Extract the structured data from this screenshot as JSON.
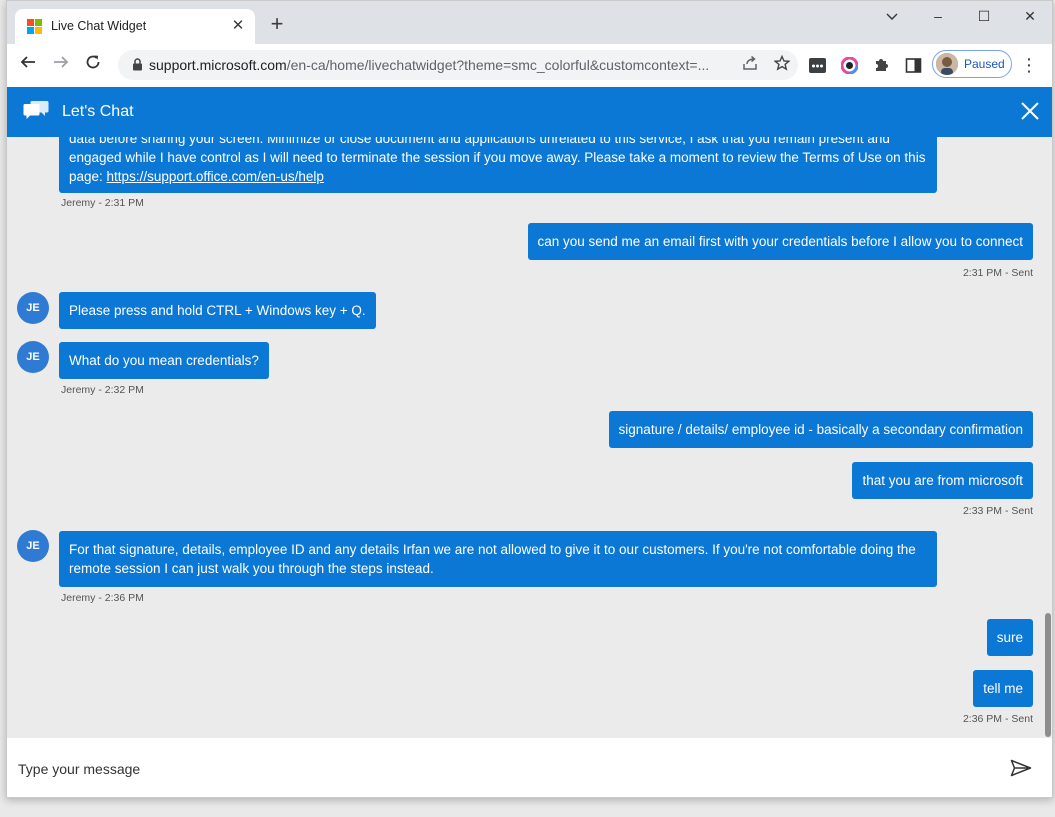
{
  "browser": {
    "tab_title": "Live Chat Widget",
    "tab_close": "✕",
    "new_tab": "+",
    "url_host": "support.microsoft.com",
    "url_rest": "/en-ca/home/livechatwidget?theme=smc_colorful&customcontext=...",
    "profile_status": "Paused",
    "window_controls": {
      "minimize": "‒",
      "maximize": "☐",
      "close": "✕"
    }
  },
  "chat": {
    "header_title": "Let's Chat",
    "input_placeholder": "Type your message",
    "messages": [
      {
        "sender": "agent",
        "text_before_link": "data before sharing your screen. Minimize or close document and applications unrelated to this service, I ask that you remain present and engaged while I have control as I will need to terminate the session if you move away. Please take a moment to review the Terms of Use on this page: ",
        "link": "https://support.office.com/en-us/help",
        "meta": "Jeremy - 2:31 PM"
      },
      {
        "sender": "user",
        "text": "can you send me an email first with your credentials before I allow you to connect",
        "meta": "2:31 PM - Sent"
      },
      {
        "sender": "agent",
        "avatar": "JE",
        "text": "Please press and hold CTRL + Windows key + Q."
      },
      {
        "sender": "agent",
        "avatar": "JE",
        "text": "What do you mean credentials?",
        "meta": "Jeremy - 2:32 PM"
      },
      {
        "sender": "user",
        "text": "signature / details/ employee id - basically a secondary confirmation"
      },
      {
        "sender": "user",
        "text": "that you are from microsoft",
        "meta": "2:33 PM - Sent"
      },
      {
        "sender": "agent",
        "avatar": "JE",
        "text": "For that signature, details, employee ID and any details Irfan we are not allowed to give it to our customers. If you're not comfortable doing the remote session I can just walk you through the steps instead.",
        "meta": "Jeremy - 2:36 PM"
      },
      {
        "sender": "user",
        "text": "sure"
      },
      {
        "sender": "user",
        "text": "tell me",
        "meta": "2:36 PM - Sent"
      }
    ]
  },
  "colors": {
    "accent": "#0b78d6",
    "chat_bg": "#ebebeb"
  }
}
